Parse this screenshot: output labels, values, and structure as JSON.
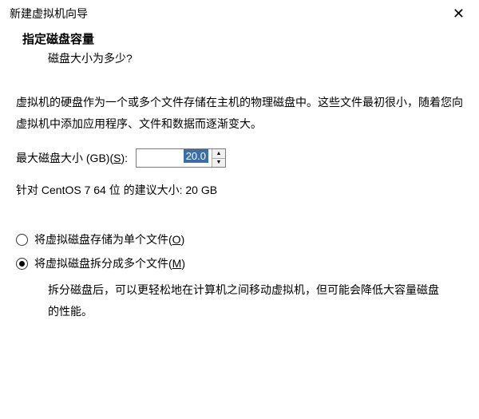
{
  "window": {
    "title": "新建虚拟机向导"
  },
  "header": {
    "title": "指定磁盘容量",
    "subtitle": "磁盘大小为多少?"
  },
  "description": "虚拟机的硬盘作为一个或多个文件存储在主机的物理磁盘中。这些文件最初很小，随着您向虚拟机中添加应用程序、文件和数据而逐渐变大。",
  "size": {
    "label_pre": "最大磁盘大小 (GB)(",
    "label_accel": "S",
    "label_post": "):",
    "value": "20.0"
  },
  "recommend": "针对 CentOS 7 64 位 的建议大小: 20 GB",
  "radios": {
    "single": {
      "pre": "将虚拟磁盘存储为单个文件(",
      "accel": "O",
      "post": ")"
    },
    "multi": {
      "pre": "将虚拟磁盘拆分成多个文件(",
      "accel": "M",
      "post": ")"
    },
    "multi_desc": "拆分磁盘后，可以更轻松地在计算机之间移动虚拟机，但可能会降低大容量磁盘的性能。"
  }
}
